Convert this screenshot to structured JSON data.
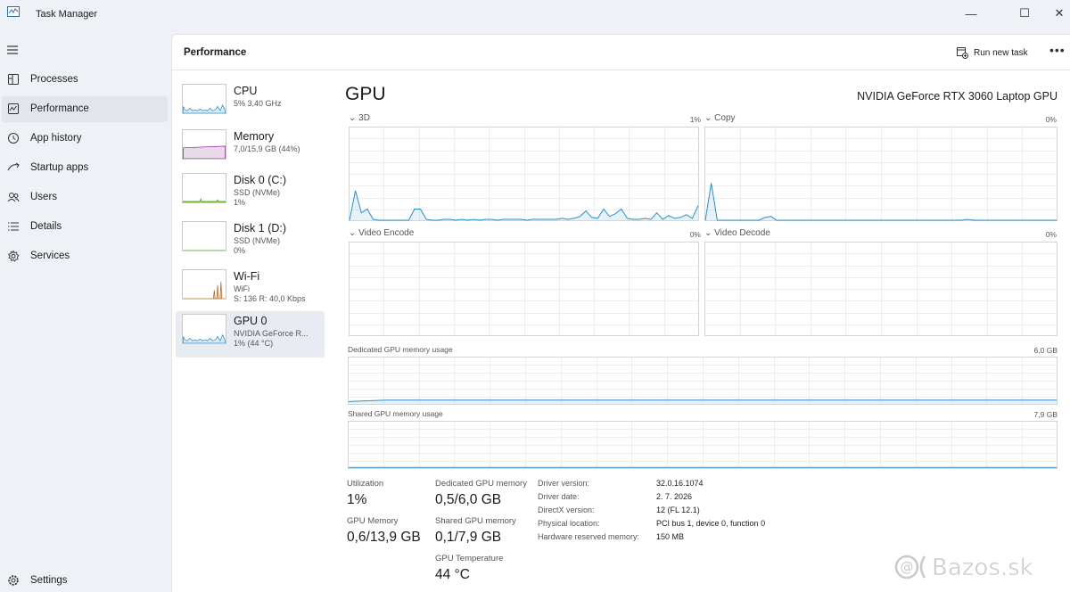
{
  "window": {
    "title": "Task Manager",
    "controls": [
      "—",
      "☐",
      "✕"
    ]
  },
  "nav": {
    "items": [
      {
        "label": "Processes",
        "icon": "processes-icon"
      },
      {
        "label": "Performance",
        "icon": "performance-icon",
        "active": true
      },
      {
        "label": "App history",
        "icon": "app-history-icon"
      },
      {
        "label": "Startup apps",
        "icon": "startup-apps-icon"
      },
      {
        "label": "Users",
        "icon": "users-icon"
      },
      {
        "label": "Details",
        "icon": "details-icon"
      },
      {
        "label": "Services",
        "icon": "services-icon"
      }
    ],
    "settings": "Settings"
  },
  "header": {
    "title": "Performance",
    "run_new_task": "Run new task",
    "more": "•••"
  },
  "devices": [
    {
      "name": "CPU",
      "line1": "5% 3,40 GHz",
      "line2": "",
      "color": "#2f8ec9",
      "level": 0.05
    },
    {
      "name": "Memory",
      "line1": "7,0/15,9 GB (44%)",
      "line2": "",
      "color": "#8b2a8b",
      "level": 0.44
    },
    {
      "name": "Disk 0 (C:)",
      "line1": "SSD (NVMe)",
      "line2": "1%",
      "color": "#4e9a06",
      "level": 0.01
    },
    {
      "name": "Disk 1 (D:)",
      "line1": "SSD (NVMe)",
      "line2": "0%",
      "color": "#4e9a06",
      "level": 0.0
    },
    {
      "name": "Wi-Fi",
      "line1": "WiFi",
      "line2": "S: 136 R: 40,0 Kbps",
      "color": "#b5651d",
      "level": 0.0
    },
    {
      "name": "GPU 0",
      "line1": "NVIDIA GeForce R...",
      "line2": "1% (44 °C)",
      "color": "#2f8ec9",
      "level": 0.01,
      "active": true
    }
  ],
  "gpu": {
    "title": "GPU",
    "model": "NVIDIA GeForce RTX 3060 Laptop GPU",
    "engines": [
      {
        "label": "3D",
        "percent": "1%"
      },
      {
        "label": "Copy",
        "percent": "0%"
      },
      {
        "label": "Video Encode",
        "percent": "0%"
      },
      {
        "label": "Video Decode",
        "percent": "0%"
      }
    ],
    "dedicated_usage": {
      "label": "Dedicated GPU memory usage",
      "max": "6,0 GB"
    },
    "shared_usage": {
      "label": "Shared GPU memory usage",
      "max": "7,9 GB"
    },
    "line_color": "#2f8ec9"
  },
  "chart_data": [
    {
      "type": "line",
      "title": "3D",
      "ylim": [
        0,
        100
      ],
      "x": [
        0,
        1,
        2,
        3,
        4,
        5,
        6,
        7,
        8,
        9,
        10,
        11,
        12,
        13,
        14,
        15,
        16,
        17,
        18,
        19,
        20,
        21,
        22,
        23,
        24,
        25,
        26,
        27,
        28,
        29,
        30,
        31,
        32,
        33,
        34,
        35,
        36,
        37,
        38,
        39,
        40,
        41,
        42,
        43,
        44,
        45,
        46,
        47,
        48,
        49,
        50,
        51,
        52,
        53,
        54,
        55,
        56,
        57,
        58,
        59
      ],
      "values": [
        0,
        32,
        8,
        12,
        1,
        0,
        0,
        0,
        0,
        0,
        0,
        12,
        12,
        1,
        0,
        0,
        1,
        1,
        0,
        1,
        0,
        1,
        0,
        1,
        1,
        0,
        1,
        1,
        1,
        1,
        0,
        1,
        1,
        1,
        1,
        1,
        2,
        1,
        2,
        4,
        10,
        3,
        2,
        12,
        4,
        7,
        12,
        2,
        1,
        1,
        2,
        1,
        8,
        1,
        5,
        2,
        3,
        6,
        2,
        16
      ]
    },
    {
      "type": "line",
      "title": "Copy",
      "ylim": [
        0,
        100
      ],
      "x": [
        0,
        1,
        2,
        3,
        4,
        5,
        6,
        7,
        8,
        9,
        10,
        11,
        12,
        13,
        14,
        15,
        16,
        17,
        18,
        19,
        20,
        21,
        22,
        23,
        24,
        25,
        26,
        27,
        28,
        29,
        30,
        31,
        32,
        33,
        34,
        35,
        36,
        37,
        38,
        39,
        40,
        41,
        42,
        43,
        44,
        45,
        46,
        47,
        48,
        49,
        50,
        51,
        52,
        53,
        54,
        55,
        56,
        57,
        58,
        59
      ],
      "values": [
        0,
        40,
        0,
        0,
        0,
        0,
        0,
        0,
        0,
        0,
        3,
        4,
        0,
        0,
        0,
        0,
        0,
        0,
        0,
        0,
        0,
        0,
        0,
        0,
        0,
        0,
        0,
        0,
        0,
        0,
        0,
        0,
        0,
        0,
        0,
        0,
        0,
        0,
        0,
        0,
        0,
        0,
        0,
        0,
        1,
        0,
        0,
        0,
        0,
        0,
        0,
        0,
        0,
        0,
        0,
        0,
        0,
        0,
        0,
        0
      ]
    },
    {
      "type": "line",
      "title": "Video Encode",
      "ylim": [
        0,
        100
      ],
      "values": []
    },
    {
      "type": "line",
      "title": "Video Decode",
      "ylim": [
        0,
        100
      ],
      "values": []
    },
    {
      "type": "line",
      "title": "Dedicated GPU memory usage",
      "ylim": [
        0,
        6.0
      ],
      "values": [
        0.3,
        0.5,
        0.5,
        0.5,
        0.5,
        0.5,
        0.5,
        0.5,
        0.5,
        0.5,
        0.5,
        0.5,
        0.5,
        0.5,
        0.5,
        0.5,
        0.5,
        0.5,
        0.5,
        0.5
      ]
    },
    {
      "type": "line",
      "title": "Shared GPU memory usage",
      "ylim": [
        0,
        7.9
      ],
      "values": [
        0.1,
        0.1,
        0.1,
        0.1,
        0.1,
        0.1,
        0.1,
        0.1,
        0.1,
        0.1,
        0.1,
        0.1,
        0.1,
        0.1,
        0.1,
        0.1,
        0.1,
        0.1,
        0.1,
        0.1
      ]
    }
  ],
  "stats": {
    "utilization": {
      "label": "Utilization",
      "value": "1%"
    },
    "dedicated_mem": {
      "label": "Dedicated GPU memory",
      "value": "0,5/6,0 GB"
    },
    "gpu_memory": {
      "label": "GPU Memory",
      "value": "0,6/13,9 GB"
    },
    "shared_mem": {
      "label": "Shared GPU memory",
      "value": "0,1/7,9 GB"
    },
    "temperature": {
      "label": "GPU Temperature",
      "value": "44 °C"
    }
  },
  "info": [
    {
      "label": "Driver version:",
      "value": "32.0.16.1074"
    },
    {
      "label": "Driver date:",
      "value": "2. 7. 2026"
    },
    {
      "label": "DirectX version:",
      "value": "12 (FL 12.1)"
    },
    {
      "label": "Physical location:",
      "value": "PCI bus 1, device 0, function 0"
    },
    {
      "label": "Hardware reserved memory:",
      "value": "150 MB"
    }
  ],
  "watermark": "Bazos.sk"
}
